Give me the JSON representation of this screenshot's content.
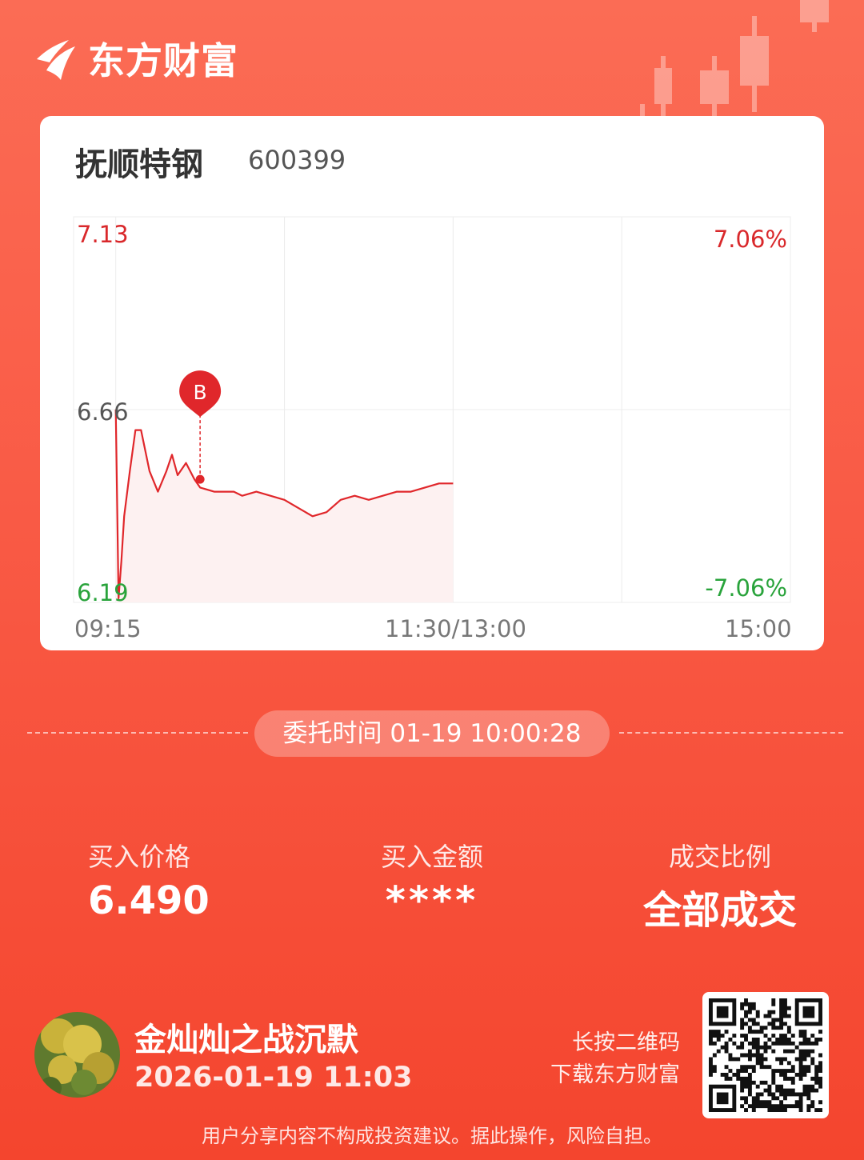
{
  "brand": {
    "name": "东方财富",
    "logo": "eastmoney-flame-logo"
  },
  "stock": {
    "name": "抚顺特钢",
    "code": "600399"
  },
  "intraday_chart": {
    "price_labels": {
      "high": "7.13",
      "mid": "6.66",
      "low": "6.19"
    },
    "pct_labels": {
      "high": "7.06%",
      "low": "-7.06%"
    },
    "time_labels": {
      "open": "09:15",
      "midday": "11:30/13:00",
      "close": "15:00"
    },
    "buy_marker": "B",
    "colors": {
      "up": "#d9282b",
      "down": "#29a33b",
      "line": "#e0272b",
      "fill": "#fdf1f1"
    }
  },
  "chart_data": {
    "type": "line",
    "title": "",
    "xlabel": "",
    "ylabel": "",
    "ylim": [
      6.19,
      7.13
    ],
    "x_ticks": [
      "09:15",
      "11:30/13:00",
      "15:00"
    ],
    "y_ticks": [
      "7.13",
      "6.66",
      "6.19"
    ],
    "x": [
      "09:30",
      "09:31",
      "09:32",
      "09:33",
      "09:35",
      "09:37",
      "09:39",
      "09:42",
      "09:45",
      "09:48",
      "09:50",
      "09:52",
      "09:55",
      "09:58",
      "10:00",
      "10:05",
      "10:08",
      "10:12",
      "10:15",
      "10:20",
      "10:25",
      "10:30",
      "10:35",
      "10:40",
      "10:45",
      "10:50",
      "10:55",
      "11:00",
      "11:05",
      "11:10",
      "11:15",
      "11:20",
      "11:25",
      "11:30"
    ],
    "values": [
      6.66,
      6.2,
      6.29,
      6.4,
      6.51,
      6.61,
      6.61,
      6.51,
      6.46,
      6.51,
      6.55,
      6.5,
      6.53,
      6.49,
      6.47,
      6.46,
      6.46,
      6.46,
      6.45,
      6.46,
      6.45,
      6.44,
      6.42,
      6.4,
      6.41,
      6.44,
      6.45,
      6.44,
      6.45,
      6.46,
      6.46,
      6.47,
      6.48,
      6.48
    ],
    "buy_point": {
      "time": "10:00",
      "price": 6.49,
      "label": "B"
    },
    "grid": true
  },
  "order": {
    "time_label": "委托时间",
    "time_value": "01-19 10:00:28"
  },
  "stats": [
    {
      "label": "买入价格",
      "value": "6.490"
    },
    {
      "label": "买入金额",
      "value": "****"
    },
    {
      "label": "成交比例",
      "value": "全部成交"
    }
  ],
  "user": {
    "name": "金灿灿之战沉默",
    "time": "2026-01-19 11:03",
    "avatar": "flower-avatar"
  },
  "qr": {
    "hint_line1": "长按二维码",
    "hint_line2": "下载东方财富",
    "icon": "qr-code-icon"
  },
  "disclaimer": "用户分享内容不构成投资建议。据此操作，风险自担。"
}
